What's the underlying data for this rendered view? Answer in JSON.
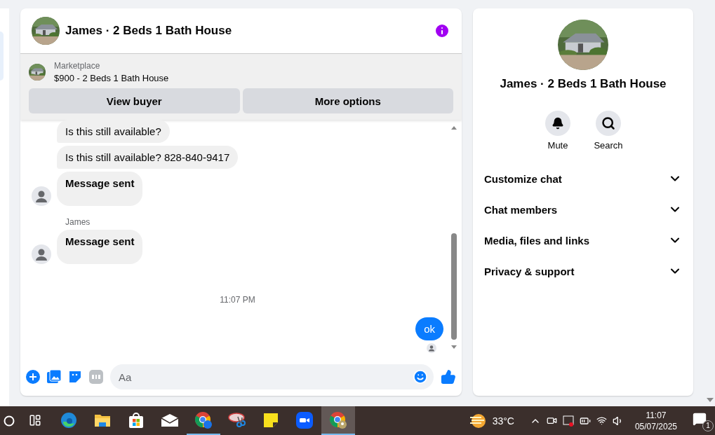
{
  "chat": {
    "title": "James · 2 Beds 1 Bath House",
    "listing": {
      "label": "Marketplace",
      "title": "$900 - 2 Beds 1 Bath House",
      "buttons": [
        "View buyer",
        "More options"
      ]
    },
    "messages": [
      {
        "kind": "incoming",
        "text": "Is this still available?",
        "bold": false,
        "avatar": false
      },
      {
        "kind": "incoming",
        "text": "Is this still available? 828-840-9417",
        "bold": false,
        "avatar": false
      },
      {
        "kind": "incoming",
        "text": "Message sent",
        "bold": true,
        "avatar": true
      },
      {
        "kind": "sender",
        "text": "James"
      },
      {
        "kind": "incoming",
        "text": "Message sent",
        "bold": true,
        "avatar": true
      },
      {
        "kind": "time",
        "text": "11:07 PM"
      },
      {
        "kind": "outgoing",
        "text": "ok",
        "seen": true
      }
    ],
    "composer": {
      "placeholder": "Aa"
    }
  },
  "profile": {
    "name": "James · 2 Beds 1 Bath House",
    "actions": [
      {
        "kind": "mute",
        "label": "Mute"
      },
      {
        "kind": "search",
        "label": "Search"
      }
    ],
    "sections": [
      {
        "label": "Customize chat",
        "expanded": false
      },
      {
        "label": "Chat members",
        "expanded": false
      },
      {
        "label": "Media, files and links",
        "expanded": false
      },
      {
        "label": "Privacy & support",
        "expanded": false
      }
    ]
  },
  "taskbar": {
    "apps": [
      {
        "kind": "edge",
        "running": false,
        "selected": false
      },
      {
        "kind": "folder",
        "running": false,
        "selected": false
      },
      {
        "kind": "store",
        "running": false,
        "selected": false
      },
      {
        "kind": "mail",
        "running": false,
        "selected": false
      },
      {
        "kind": "chrome-m",
        "running": true,
        "selected": false
      },
      {
        "kind": "snip",
        "running": false,
        "selected": false
      },
      {
        "kind": "notes",
        "running": false,
        "selected": false
      },
      {
        "kind": "zoom",
        "running": false,
        "selected": false
      },
      {
        "kind": "chrome-profile",
        "running": true,
        "selected": true
      }
    ],
    "weather": "33°C",
    "time": "11:07",
    "date": "05/07/2025",
    "notifications": "1"
  }
}
